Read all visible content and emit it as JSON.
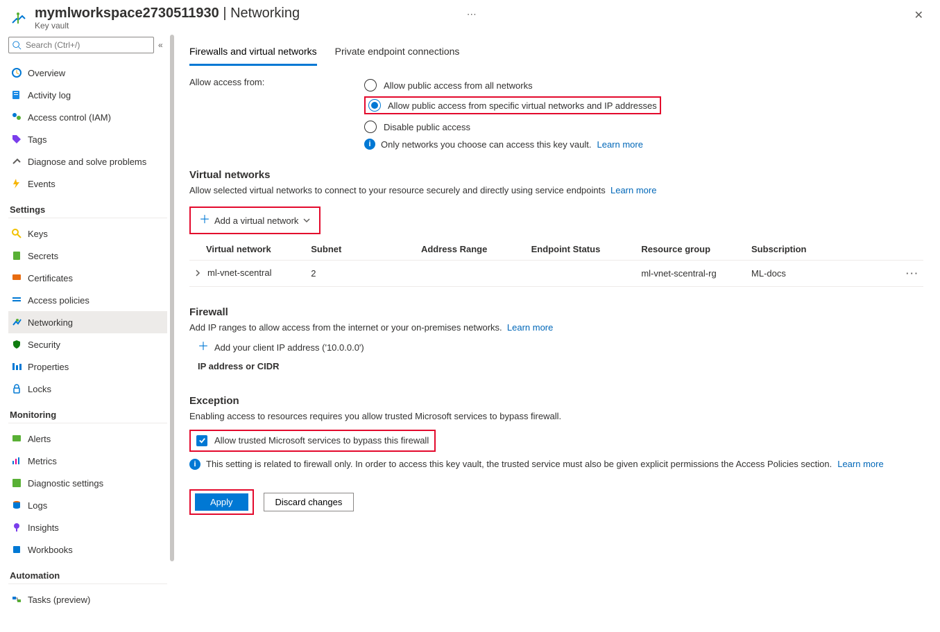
{
  "header": {
    "title_main": "mymlworkspace2730511930",
    "title_section": "Networking",
    "subtitle": "Key vault"
  },
  "search": {
    "placeholder": "Search (Ctrl+/)"
  },
  "nav": {
    "items_top": [
      {
        "label": "Overview"
      },
      {
        "label": "Activity log"
      },
      {
        "label": "Access control (IAM)"
      },
      {
        "label": "Tags"
      },
      {
        "label": "Diagnose and solve problems"
      },
      {
        "label": "Events"
      }
    ],
    "group_settings": "Settings",
    "items_settings": [
      {
        "label": "Keys"
      },
      {
        "label": "Secrets"
      },
      {
        "label": "Certificates"
      },
      {
        "label": "Access policies"
      },
      {
        "label": "Networking"
      },
      {
        "label": "Security"
      },
      {
        "label": "Properties"
      },
      {
        "label": "Locks"
      }
    ],
    "group_monitoring": "Monitoring",
    "items_monitoring": [
      {
        "label": "Alerts"
      },
      {
        "label": "Metrics"
      },
      {
        "label": "Diagnostic settings"
      },
      {
        "label": "Logs"
      },
      {
        "label": "Insights"
      },
      {
        "label": "Workbooks"
      }
    ],
    "group_automation": "Automation",
    "items_automation": [
      {
        "label": "Tasks (preview)"
      }
    ]
  },
  "tabs": {
    "firewalls": "Firewalls and virtual networks",
    "private": "Private endpoint connections"
  },
  "access": {
    "label": "Allow access from:",
    "opt_all": "Allow public access from all networks",
    "opt_specific": "Allow public access from specific virtual networks and IP addresses",
    "opt_disable": "Disable public access",
    "info_text": "Only networks you choose can access this key vault.",
    "learn_more": "Learn more"
  },
  "vnet": {
    "heading": "Virtual networks",
    "sub": "Allow selected virtual networks to connect to your resource securely and directly using service endpoints",
    "learn_more": "Learn more",
    "add_btn": "Add a virtual network",
    "columns": {
      "c1": "Virtual network",
      "c2": "Subnet",
      "c3": "Address Range",
      "c4": "Endpoint Status",
      "c5": "Resource group",
      "c6": "Subscription"
    },
    "row": {
      "name": "ml-vnet-scentral",
      "subnet": "2",
      "range": "",
      "status": "",
      "rg": "ml-vnet-scentral-rg",
      "sub": "ML-docs"
    }
  },
  "firewall": {
    "heading": "Firewall",
    "sub": "Add IP ranges to allow access from the internet or your on-premises networks.",
    "learn_more": "Learn more",
    "add_client": "Add your client IP address ('10.0.0.0')",
    "ip_label": "IP address or CIDR"
  },
  "exception": {
    "heading": "Exception",
    "sub": "Enabling access to resources requires you allow trusted Microsoft services to bypass firewall.",
    "chk_label": "Allow trusted Microsoft services to bypass this firewall",
    "info_text": "This setting is related to firewall only. In order to access this key vault, the trusted service must also be given explicit permissions the Access Policies section.",
    "learn_more": "Learn more"
  },
  "buttons": {
    "apply": "Apply",
    "discard": "Discard changes"
  }
}
